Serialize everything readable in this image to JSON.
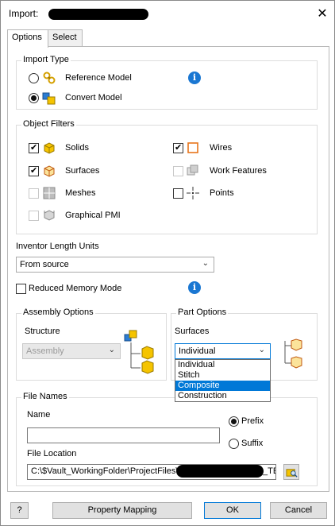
{
  "window": {
    "title": "Import:",
    "close_glyph": "✕"
  },
  "tabs": [
    {
      "label": "Options"
    },
    {
      "label": "Select"
    }
  ],
  "import_type": {
    "title": "Import Type",
    "options": [
      {
        "label": "Reference Model",
        "checked": false,
        "icon": "reference-model-icon"
      },
      {
        "label": "Convert Model",
        "checked": true,
        "icon": "convert-model-icon"
      }
    ],
    "info_glyph": "i"
  },
  "object_filters": {
    "title": "Object Filters",
    "items": [
      {
        "label": "Solids",
        "checked": true,
        "enabled": true
      },
      {
        "label": "Surfaces",
        "checked": true,
        "enabled": true
      },
      {
        "label": "Meshes",
        "checked": false,
        "enabled": false
      },
      {
        "label": "Graphical PMI",
        "checked": false,
        "enabled": false
      },
      {
        "label": "Wires",
        "checked": true,
        "enabled": true
      },
      {
        "label": "Work Features",
        "checked": false,
        "enabled": false
      },
      {
        "label": "Points",
        "checked": false,
        "enabled": true
      }
    ]
  },
  "length_units": {
    "label": "Inventor Length Units",
    "selected": "From source"
  },
  "reduced_memory": {
    "label": "Reduced Memory Mode",
    "checked": false,
    "info_glyph": "i"
  },
  "assembly_options": {
    "title": "Assembly Options",
    "structure_label": "Structure",
    "structure_value": "Assembly"
  },
  "part_options": {
    "title": "Part Options",
    "surfaces_label": "Surfaces",
    "surfaces_value": "Individual",
    "dropdown_options": [
      "Individual",
      "Stitch",
      "Composite",
      "Construction"
    ],
    "highlighted_option": "Composite"
  },
  "file_names": {
    "title": "File Names",
    "name_label": "Name",
    "name_value": "",
    "prefix_label": "Prefix",
    "suffix_label": "Suffix",
    "prefix_selected": true,
    "location_label": "File Location",
    "location_value": "C:\\$Vault_WorkingFolder\\ProjectFiles\\",
    "location_suffix": "_TEI"
  },
  "footer": {
    "help_glyph": "?",
    "property_mapping_label": "Property Mapping",
    "ok_label": "OK",
    "cancel_label": "Cancel"
  },
  "colors": {
    "accent": "#0078d7",
    "info": "#1a77d2",
    "icon_yellow": "#f5c400",
    "icon_orange": "#e8741a"
  }
}
